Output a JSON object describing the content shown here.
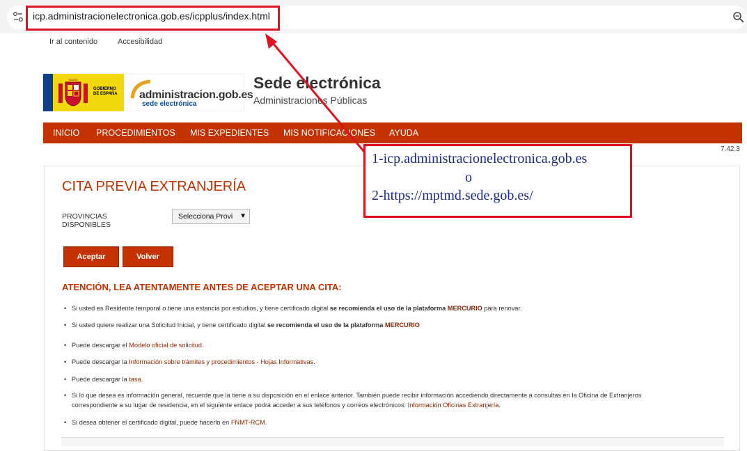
{
  "browser": {
    "url": "icp.administracionelectronica.gob.es/icpplus/index.html"
  },
  "skip_links": {
    "content": "Ir al contenido",
    "accessibility": "Accesibilidad"
  },
  "header": {
    "gobierno_text": [
      "GOBIERNO",
      "DE ESPAÑA"
    ],
    "admin_logo_main": "administracion.gob.es",
    "admin_logo_sub": "sede electrónica",
    "title": "Sede electrónica",
    "subtitle": "Administraciones Públicas"
  },
  "nav": {
    "items": [
      "INICIO",
      "PROCEDIMIENTOS",
      "MIS EXPEDIENTES",
      "MIS NOTIFICACIONES",
      "AYUDA"
    ]
  },
  "version": "7.42.3",
  "form": {
    "title": "CITA PREVIA EXTRANJERÍA",
    "province_label_1": "PROVINCIAS",
    "province_label_2": "DISPONIBLES",
    "province_selected": "Selecciona Provi",
    "accept": "Aceptar",
    "back": "Volver"
  },
  "warning": "ATENCIÓN, LEA ATENTAMENTE ANTES DE ACEPTAR UNA CITA:",
  "bullets": {
    "b1_pre": "Si usted es Residente temporal o tiene una estancia por estudios, y tiene certificado digital ",
    "b1_bold": "se recomienda el uso de la plataforma ",
    "b1_link": "MERCURIO",
    "b1_post": " para renovar.",
    "b2_pre": "Si usted quiere realizar una Solicitud Inicial, y tiene certificado digital ",
    "b2_bold": "se recomienda el uso de la plataforma ",
    "b2_link": "MERCURIO",
    "b3_pre": "Puede descargar el ",
    "b3_link": "Modelo oficial de solicitud",
    "b3_post": ".",
    "b4_pre": "Puede descargar la ",
    "b4_link": "Información sobre trámites y procedimientos - Hojas Informativas",
    "b4_post": ".",
    "b5_pre": "Puede descargar la ",
    "b5_link": "tasa",
    "b5_post": ".",
    "b6_line1": "Si lo que desea es información general, recuerde que la tiene a su disposición en el enlace anterior. También puede recibir información accediendo directamente a consultas en la Oficina de Extranjeros",
    "b6_line2_pre": "correspondiente a su lugar de residencia, en el siguiente enlace podrá acceder a sus teléfonos y correos electrónicos: ",
    "b6_link": "Información Oficinas Extranjería",
    "b6_post": ".",
    "b7_pre": "Si desea obtener el certificado digital, puede hacerlo en ",
    "b7_link": "FNMT-RCM",
    "b7_post": "."
  },
  "annotation": {
    "line1": "1-icp.administracionelectronica.gob.es",
    "line2": "o",
    "line3": "2-https://mptmd.sede.gob.es/"
  },
  "colors": {
    "brand_red": "#c33200",
    "annotation_red": "#e0101e",
    "annotation_text": "#1a2a8a"
  }
}
